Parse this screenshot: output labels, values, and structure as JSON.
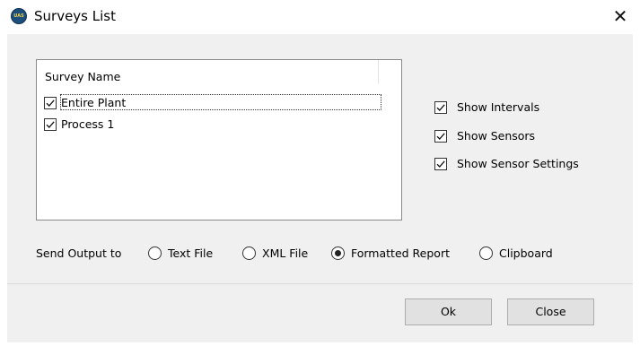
{
  "window": {
    "title": "Surveys List",
    "app_icon_text": "UAS",
    "close_glyph": "✕",
    "icon": "close-icon"
  },
  "survey_list": {
    "column_header": "Survey Name",
    "items": [
      {
        "label": "Entire Plant",
        "checked": true
      },
      {
        "label": "Process 1",
        "checked": true
      }
    ]
  },
  "options": [
    {
      "label": "Show Intervals",
      "checked": true
    },
    {
      "label": "Show Sensors",
      "checked": true
    },
    {
      "label": "Show Sensor Settings",
      "checked": true
    }
  ],
  "output": {
    "label": "Send Output to",
    "choices": [
      {
        "label": "Text File",
        "selected": false
      },
      {
        "label": "XML File",
        "selected": false
      },
      {
        "label": "Formatted Report",
        "selected": true
      },
      {
        "label": "Clipboard",
        "selected": false
      }
    ]
  },
  "buttons": {
    "ok": "Ok",
    "close": "Close"
  },
  "colors": {
    "dialog_background": "#f0f0f0",
    "button_background": "#e1e1e1",
    "app_icon": "#1d4f7c"
  }
}
